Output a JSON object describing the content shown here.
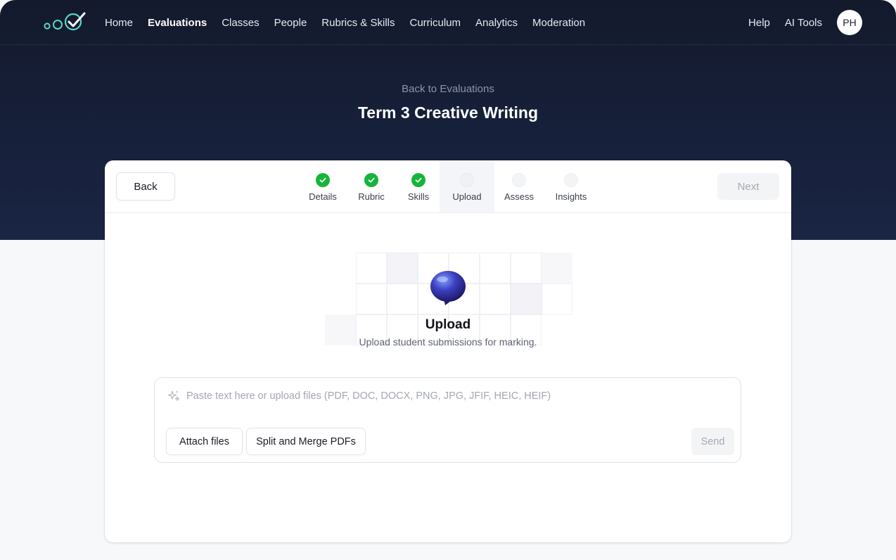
{
  "nav": {
    "links": [
      "Home",
      "Evaluations",
      "Classes",
      "People",
      "Rubrics & Skills",
      "Curriculum",
      "Analytics",
      "Moderation"
    ],
    "active": "Evaluations",
    "right_links": [
      "Help",
      "AI Tools"
    ],
    "avatar_initials": "PH"
  },
  "header": {
    "back_link": "Back to Evaluations",
    "title": "Term 3 Creative Writing"
  },
  "wizard": {
    "back_label": "Back",
    "next_label": "Next",
    "steps": [
      {
        "label": "Details",
        "state": "done"
      },
      {
        "label": "Rubric",
        "state": "done"
      },
      {
        "label": "Skills",
        "state": "done"
      },
      {
        "label": "Upload",
        "state": "current"
      },
      {
        "label": "Assess",
        "state": "todo"
      },
      {
        "label": "Insights",
        "state": "todo"
      }
    ]
  },
  "upload": {
    "icon": "speech-bubble-icon",
    "title": "Upload",
    "subtitle": "Upload student submissions for marking."
  },
  "composer": {
    "placeholder": "Paste text here or upload files (PDF, DOC, DOCX, PNG, JPG, JFIF, HEIC, HEIF)",
    "attach_label": "Attach files",
    "split_label": "Split and Merge PDFs",
    "send_label": "Send"
  },
  "colors": {
    "hero_bg": "#141a2c",
    "done_green": "#14b53a",
    "logo_teal": "#5ed3c6"
  }
}
